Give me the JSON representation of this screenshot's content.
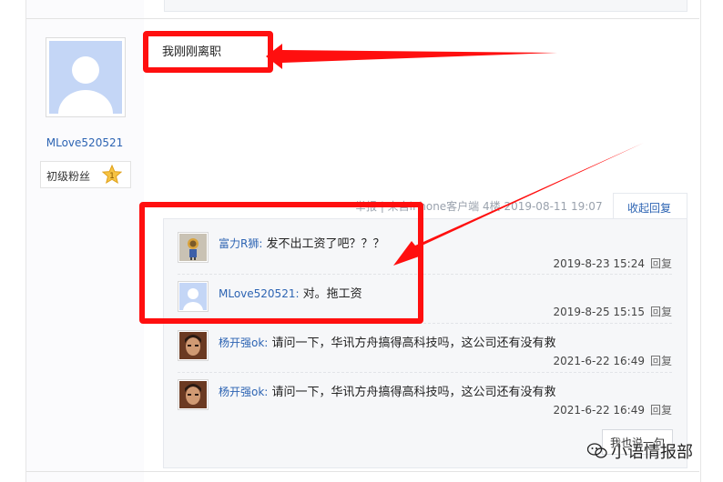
{
  "post": {
    "username": "MLove520521",
    "rank_label": "初级粉丝",
    "rank_level": "1",
    "content": "我刚刚离职",
    "meta": "举报 | 来自iPhone客户端   4楼   2019-08-11 19:07",
    "collapse_label": "收起回复"
  },
  "replies": [
    {
      "author": "富力R狮",
      "text": "发不出工资了吧？？？",
      "time": "2019-8-23 15:24",
      "reply_label": "回复"
    },
    {
      "author": "MLove520521",
      "text": "对。拖工资",
      "time": "2019-8-25 15:15",
      "reply_label": "回复"
    },
    {
      "author": "杨开强ok",
      "text": "请问一下，华讯方舟搞得高科技吗，这公司还有没有救",
      "time": "2021-6-22 16:49",
      "reply_label": "回复"
    },
    {
      "author": "杨开强ok",
      "text": "请问一下，华讯方舟搞得高科技吗，这公司还有没有救",
      "time": "2021-6-22 16:49",
      "reply_label": "回复"
    }
  ],
  "say_button_label": "我也说一句",
  "watermark": "小语情报部",
  "colors": {
    "highlight": "#ff0f0f",
    "link": "#2d64b3",
    "reply_bg": "#f6f7f9"
  }
}
